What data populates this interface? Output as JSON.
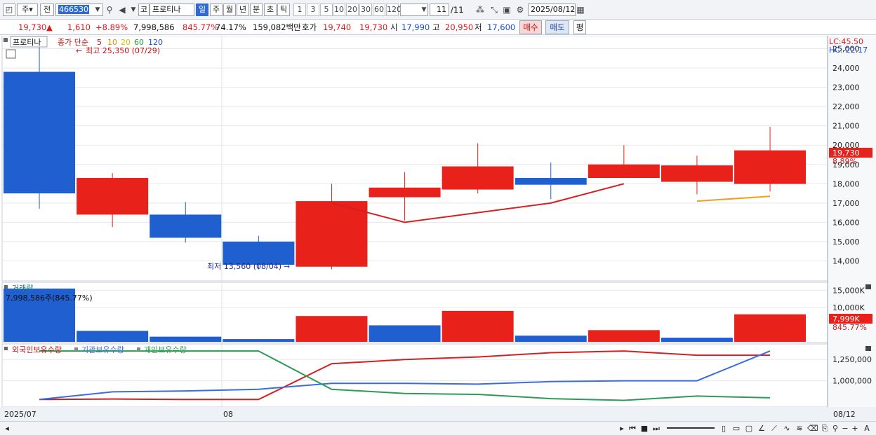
{
  "toolbar": {
    "period_label": "주",
    "prev_label": "전",
    "code": "466530",
    "market_label": "코",
    "stock_name": "프로티나",
    "period_buttons": [
      "일",
      "주",
      "월",
      "년",
      "분",
      "초",
      "틱"
    ],
    "interval_buttons": [
      "1",
      "3",
      "5",
      "10",
      "20",
      "30",
      "60",
      "120"
    ],
    "count": "11",
    "count_total": "/11",
    "date": "2025/08/12"
  },
  "quote": {
    "price": "19,730",
    "arrow": "▲",
    "change": "1,610",
    "change_pct": "+8.89%",
    "volume": "7,998,586",
    "volume_pct": "845.77%",
    "turnover": "74.17%",
    "amount": "159,082백만",
    "bid_label": "호가",
    "bid": "19,740",
    "ask": "19,730",
    "open_label": "시",
    "open": "17,990",
    "high_label": "고",
    "high": "20,950",
    "low_label": "저",
    "low": "17,600",
    "buy_label": "매수",
    "sell_label": "매도",
    "eval_label": "평"
  },
  "price_panel": {
    "name_tag": "프로티나",
    "ma_title": "종가 단순",
    "ma_periods": [
      "5",
      "10",
      "20",
      "60",
      "120"
    ],
    "high_note": "최고 25,350 (07/29)",
    "low_note": "최저 13,560 (08/04)",
    "lc": "LC:45.50",
    "hc": "HC:-22.17",
    "last_price": "19,730",
    "last_pct": "8.89%"
  },
  "volume_panel": {
    "title": "거래량",
    "summary": "7,998,586주(845.77%)",
    "last_value": "7,999K",
    "last_pct": "845.77%"
  },
  "holding_panel": {
    "titles": [
      "외국인보유수량",
      "기관보유수량",
      "개인보유수량"
    ]
  },
  "x_axis": {
    "labels": [
      "2025/07",
      "08",
      "08/12"
    ]
  },
  "colors": {
    "up": "#e8211a",
    "down": "#1f5fd0",
    "ma5": "#d42020",
    "ma10": "#f0a020",
    "foreign": "#d42020",
    "institution": "#3a6ee0",
    "individual": "#2e9a55"
  },
  "chart_data": [
    {
      "type": "candlestick",
      "title": "프로티나",
      "x": [
        "P1",
        "P2",
        "P3",
        "P4",
        "P5",
        "P6",
        "P7",
        "P8",
        "P9",
        "P10",
        "P11"
      ],
      "open": [
        23800,
        16400,
        16400,
        15000,
        13700,
        17300,
        17700,
        18300,
        18300,
        18100,
        17990
      ],
      "close": [
        17500,
        18300,
        15200,
        13800,
        17100,
        17800,
        18900,
        17950,
        19000,
        18950,
        19730
      ],
      "high": [
        25350,
        18550,
        17050,
        15300,
        18000,
        18600,
        20100,
        19100,
        20000,
        19450,
        20950
      ],
      "low": [
        16700,
        15750,
        14950,
        13560,
        13560,
        16100,
        17500,
        17200,
        18300,
        17450,
        17600
      ],
      "ma5": [
        null,
        null,
        null,
        null,
        17000,
        16000,
        null,
        17000,
        18000,
        null,
        null
      ],
      "ma10": [
        null,
        null,
        null,
        null,
        null,
        null,
        null,
        null,
        null,
        17100,
        17350
      ],
      "y_ticks": [
        14000,
        15000,
        16000,
        17000,
        18000,
        19000,
        20000,
        21000,
        22000,
        23000,
        24000,
        25000
      ],
      "ylim": [
        13000,
        25600
      ]
    },
    {
      "type": "bar",
      "title": "거래량",
      "x": [
        "P1",
        "P2",
        "P3",
        "P4",
        "P5",
        "P6",
        "P7",
        "P8",
        "P9",
        "P10",
        "P11"
      ],
      "values": [
        15500000,
        3200000,
        1500000,
        800000,
        7500000,
        4800000,
        9000000,
        1800000,
        3400000,
        1200000,
        7998586
      ],
      "direction": [
        "down",
        "down",
        "down",
        "down",
        "up",
        "down",
        "up",
        "down",
        "up",
        "down",
        "up"
      ],
      "y_ticks": [
        10000000,
        15000000
      ],
      "y_tick_labels": [
        "10,000K",
        "15,000K"
      ],
      "ylim": [
        0,
        16500000
      ]
    },
    {
      "type": "line",
      "x": [
        "P1",
        "P2",
        "P3",
        "P4",
        "P5",
        "P6",
        "P7",
        "P8",
        "P9",
        "P10",
        "P11"
      ],
      "series": [
        {
          "name": "외국인보유수량",
          "values": [
            780000,
            785000,
            780000,
            780000,
            1200000,
            1250000,
            1280000,
            1330000,
            1350000,
            1300000,
            1300000
          ]
        },
        {
          "name": "기관보유수량",
          "values": [
            780000,
            870000,
            880000,
            900000,
            970000,
            970000,
            960000,
            990000,
            1000000,
            1000000,
            1350000
          ]
        },
        {
          "name": "개인보유수량",
          "values": [
            1350000,
            1350000,
            1350000,
            1350000,
            900000,
            850000,
            840000,
            790000,
            770000,
            820000,
            800000
          ]
        }
      ],
      "y_ticks": [
        1000000,
        1250000
      ],
      "y_tick_labels": [
        "1,000,000",
        "1,250,000"
      ],
      "ylim": [
        700000,
        1400000
      ]
    }
  ]
}
